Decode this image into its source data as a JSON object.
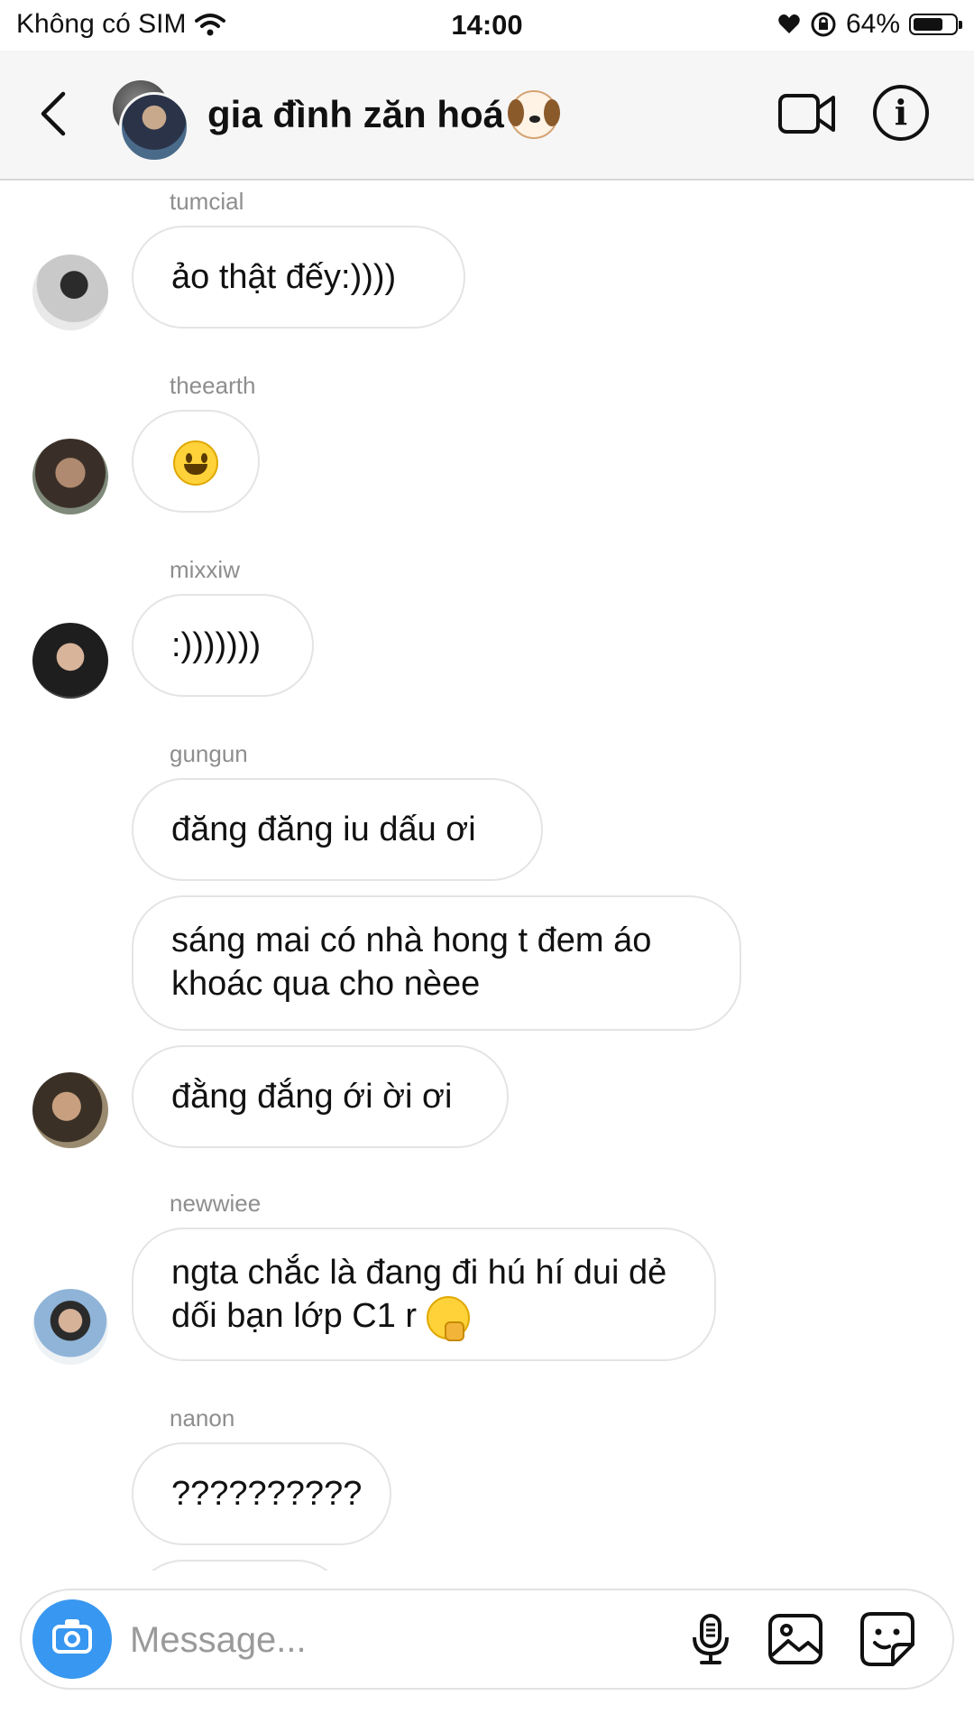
{
  "status_bar": {
    "carrier": "Không có SIM",
    "time": "14:00",
    "battery_text": "64%",
    "battery_level": 0.64
  },
  "header": {
    "title": "gia đình zăn hoá",
    "title_emoji_icon": "dog-face-icon"
  },
  "messages": [
    {
      "sender": "tumcial",
      "bubbles": [
        "ảo thật đếy:))))"
      ]
    },
    {
      "sender": "theearth",
      "bubbles": [
        ""
      ],
      "emoji": "smiley-emoji"
    },
    {
      "sender": "mixxiw",
      "bubbles": [
        ":)))))))"
      ]
    },
    {
      "sender": "gungun",
      "bubbles": [
        "đăng đăng iu dấu ơi",
        "sáng mai có nhà hong t đem áo khoác qua cho nèee",
        "đằng đắng ới ời ơi"
      ]
    },
    {
      "sender": "newwiee",
      "bubbles": [
        "ngta chắc là đang đi hú hí dui dẻ dối bạn lớp C1 r"
      ]
    },
    {
      "sender": "nanon",
      "bubbles": [
        "??????????"
      ]
    }
  ],
  "composer": {
    "placeholder": "Message..."
  },
  "colors": {
    "accent": "#3897f0",
    "bubble_border": "#e4e4e4",
    "sender_text": "#8e8e8e"
  }
}
